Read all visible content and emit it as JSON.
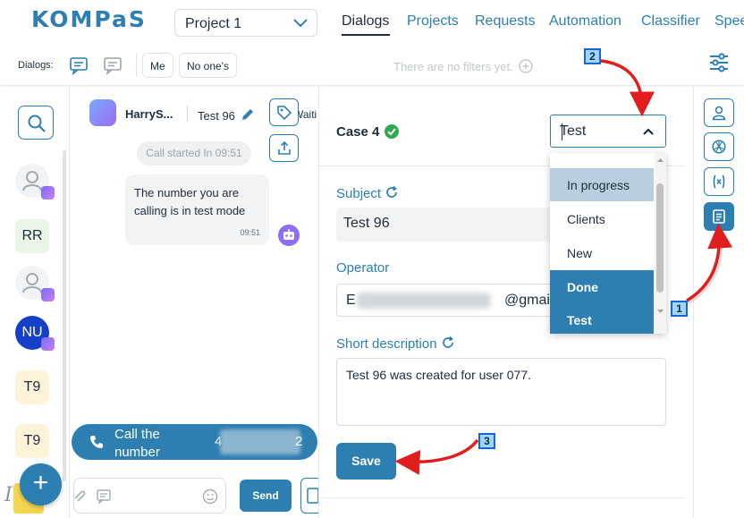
{
  "header": {
    "logo": "KOMPaS",
    "project": "Project 1",
    "nav": [
      "Dialogs",
      "Projects",
      "Requests",
      "Automation",
      "Classifier",
      "Spee"
    ]
  },
  "filterbar": {
    "dialogs_label": "Dialogs:",
    "chip_me": "Me",
    "chip_none": "No one's",
    "no_filters": "There are no filters yet."
  },
  "leftrail": {
    "avatars": [
      "RR",
      "NU",
      "T9",
      "T9"
    ]
  },
  "chat": {
    "contact_name": "HarryS...",
    "case_ref": "Test 96",
    "truncated": "Waiting",
    "call_started": "Call started In 09:51",
    "message": "The number you are calling is in test mode",
    "message_time": "09:51",
    "call_label": "Call the number",
    "call_number_start": "4",
    "call_number_end": "2",
    "send": "Send"
  },
  "panel": {
    "case_title": "Case 4",
    "status_value": "Test",
    "status_options": [
      "In progress",
      "Clients",
      "New",
      "Done",
      "Test"
    ],
    "subject_label": "Subject",
    "subject_value": "Test 96",
    "operator_label": "Operator",
    "operator_prefix": "E",
    "operator_suffix": "@gmail",
    "description_label": "Short description",
    "description_value": "Test 96 was created for user 077.",
    "save": "Save"
  },
  "annotations": {
    "steps": [
      "1",
      "2",
      "3"
    ]
  },
  "colors": {
    "accent": "#2d7fb2",
    "annotation_arrow": "#e01e1e",
    "success": "#2fa84f"
  }
}
